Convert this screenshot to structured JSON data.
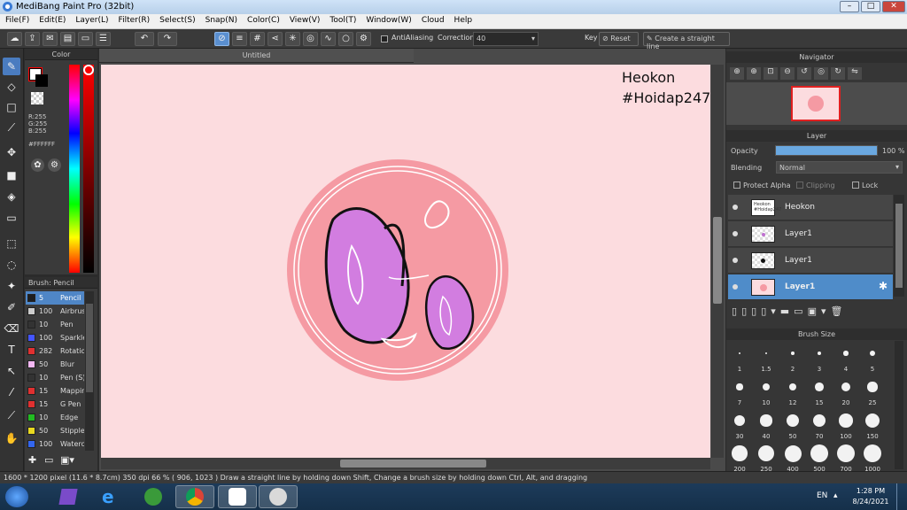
{
  "window": {
    "title": "MediBang Paint Pro (32bit)"
  },
  "menu": [
    "File(F)",
    "Edit(E)",
    "Layer(L)",
    "Filter(R)",
    "Select(S)",
    "Snap(N)",
    "Color(C)",
    "View(V)",
    "Tool(T)",
    "Window(W)",
    "Cloud",
    "Help"
  ],
  "toolbar": {
    "antialiasing_label": "AntiAliasing",
    "correction_label": "Correction",
    "correction_value": "40",
    "key_label": "Key",
    "reset_label": "Reset",
    "straight_line_label": "Create a straight line"
  },
  "color_panel": {
    "title": "Color",
    "r": "R:255",
    "g": "G:255",
    "b": "B:255",
    "hex": "#FFFFFF"
  },
  "brush_panel": {
    "title": "Brush: Pencil",
    "items": [
      {
        "size": "5",
        "name": "Pencil",
        "color": "#1e1e1e",
        "selected": true
      },
      {
        "size": "100",
        "name": "Airbrush",
        "color": "#cccccc"
      },
      {
        "size": "10",
        "name": "Pen",
        "color": "#333333"
      },
      {
        "size": "100",
        "name": "Sparkle",
        "color": "#4455ff"
      },
      {
        "size": "282",
        "name": "Rotation",
        "color": "#e03030"
      },
      {
        "size": "50",
        "name": "Blur",
        "color": "#f4b8f4"
      },
      {
        "size": "10",
        "name": "Pen (S)",
        "color": "#333333"
      },
      {
        "size": "15",
        "name": "Mapping",
        "color": "#e03030"
      },
      {
        "size": "15",
        "name": "G Pen",
        "color": "#e03030"
      },
      {
        "size": "10",
        "name": "Edge",
        "color": "#22bb22"
      },
      {
        "size": "50",
        "name": "Stipple",
        "color": "#e8d820"
      },
      {
        "size": "100",
        "name": "Watercolor",
        "color": "#3366ee"
      }
    ]
  },
  "document": {
    "tab_title": "Untitled",
    "watermark_line1": "Heokon",
    "watermark_line2": "#Hoidap247",
    "background": "#fcdcdf"
  },
  "navigator": {
    "title": "Navigator"
  },
  "layer_panel": {
    "title": "Layer",
    "opacity_label": "Opacity",
    "opacity_value": "100 %",
    "opacity_fraction": 1.0,
    "blending_label": "Blending",
    "blending_value": "Normal",
    "protect_alpha": "Protect Alpha",
    "clipping": "Clipping",
    "lock": "Lock",
    "layers": [
      {
        "name": "Heokon",
        "selected": false
      },
      {
        "name": "Layer1",
        "selected": false
      },
      {
        "name": "Layer1",
        "selected": false
      },
      {
        "name": "Layer1",
        "selected": true
      }
    ]
  },
  "brush_size_panel": {
    "title": "Brush Size",
    "sizes": [
      "1",
      "1.5",
      "2",
      "3",
      "4",
      "5",
      "7",
      "10",
      "12",
      "15",
      "20",
      "25",
      "30",
      "40",
      "50",
      "70",
      "100",
      "150",
      "200",
      "250",
      "400",
      "500",
      "700",
      "1000"
    ]
  },
  "status": {
    "text": "1600 * 1200 pixel   (11.6 * 8.7cm)   350 dpi   66 %   ( 906, 1023 )   Draw a straight line by holding down Shift, Change a brush size by holding down Ctrl, Alt, and dragging"
  },
  "taskbar": {
    "language": "EN",
    "time": "1:28 PM",
    "date": "8/24/2021"
  },
  "colors": {
    "accent": "#4f8cc9",
    "circle_outer": "#f59aa3",
    "blob": "#d27de0"
  }
}
